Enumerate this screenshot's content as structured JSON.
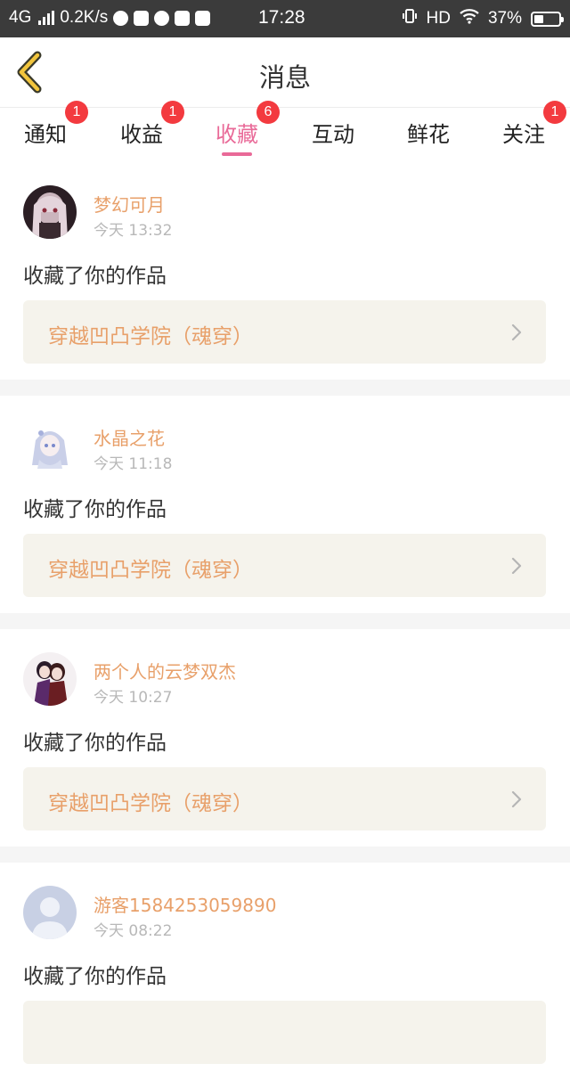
{
  "status_bar": {
    "network": "4G",
    "speed": "0.2K/s",
    "time": "17:28",
    "hd": "HD",
    "battery": "37%",
    "battery_level": 0.37
  },
  "header": {
    "title": "消息"
  },
  "tabs": [
    {
      "label": "通知",
      "badge": "1"
    },
    {
      "label": "收益",
      "badge": "1"
    },
    {
      "label": "收藏",
      "badge": "6",
      "active": true
    },
    {
      "label": "互动",
      "badge": ""
    },
    {
      "label": "鲜花",
      "badge": ""
    },
    {
      "label": "关注",
      "badge": "1"
    }
  ],
  "messages": [
    {
      "user": "梦幻可月",
      "time": "今天 13:32",
      "action": "收藏了你的作品",
      "work": "穿越凹凸学院（魂穿）"
    },
    {
      "user": "水晶之花",
      "time": "今天 11:18",
      "action": "收藏了你的作品",
      "work": "穿越凹凸学院（魂穿）"
    },
    {
      "user": "两个人的云梦双杰",
      "time": "今天 10:27",
      "action": "收藏了你的作品",
      "work": "穿越凹凸学院（魂穿）"
    },
    {
      "user": "游客1584253059890",
      "time": "今天 08:22",
      "action": "收藏了你的作品",
      "work": ""
    }
  ],
  "colors": {
    "accent_pink": "#e96a98",
    "badge_red": "#f33a3f",
    "username_orange": "#e8a06a",
    "work_bg": "#f5f3ec"
  }
}
